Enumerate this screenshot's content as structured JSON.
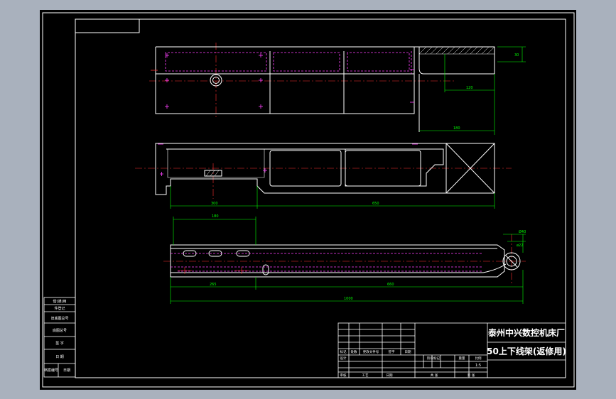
{
  "title_block": {
    "company": "泰州中兴数控机床厂",
    "drawing_name": "50上下线架(返修用)",
    "scale": "1:5",
    "cells": {
      "r1a": "标记",
      "r1b": "处数",
      "r1c": "更改文件号",
      "r1d": "签字",
      "r1e": "日期",
      "r2a": "设计",
      "r3a": "审核",
      "r3b": "工艺",
      "r3c": "日期",
      "stage": "阶段标记",
      "weight": "重量",
      "ratio": "比例",
      "sheet_total": "共   张",
      "sheet_no": "第   张"
    }
  },
  "side_table": {
    "rows": [
      "借(通)用",
      "件登记",
      "旧底图总号",
      "底图总号",
      "签  字",
      "日  期"
    ],
    "bottom": [
      "档案编号",
      "日期"
    ]
  },
  "dimensions": {
    "v1_height": "30",
    "v1_width_a": "120",
    "v1_width_b": "180",
    "v2_left": "300",
    "v2_right": "650",
    "v3_top": "180",
    "v3_left": "265",
    "v3_mid": "660",
    "v3_total": "1000",
    "v3_dia": "Ø40",
    "v3_small": "ø22"
  }
}
